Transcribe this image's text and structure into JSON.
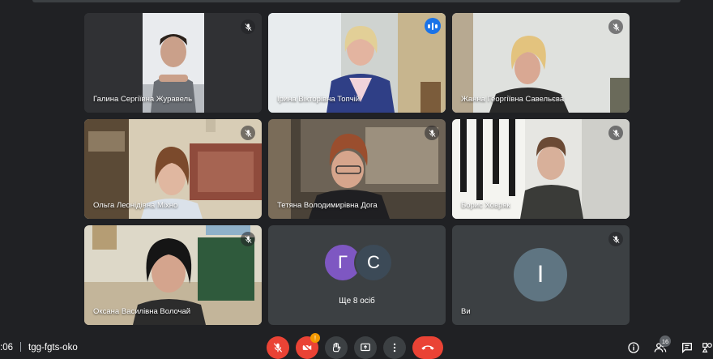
{
  "participants": [
    {
      "name": "Галина Сергіївна Журавель",
      "muted": true
    },
    {
      "name": "Ірина Вікторівна Топчій",
      "muted": false,
      "speaking": true
    },
    {
      "name": "Жанна Георгіївна Савельєва",
      "muted": true
    },
    {
      "name": "Ольга Леонідівна Міхно",
      "muted": true
    },
    {
      "name": "Тетяна Володимирівна Дога",
      "muted": true
    },
    {
      "name": "Борис Ховряк",
      "muted": true
    },
    {
      "name": "Оксана Василівна Волочай",
      "muted": true
    }
  ],
  "overflow": {
    "initials": [
      "Г",
      "С"
    ],
    "label": "Ще 8 осіб"
  },
  "self": {
    "initial": "І",
    "name": "Ви"
  },
  "meeting": {
    "time": ":06",
    "code": "tgg-fgts-oko"
  },
  "controls": {
    "camera_badge": "!"
  },
  "people_count": "16",
  "colors": {
    "accent": "#1a73e8",
    "end_call": "#ea4335",
    "background": "#202124",
    "tile": "#3c4043"
  }
}
